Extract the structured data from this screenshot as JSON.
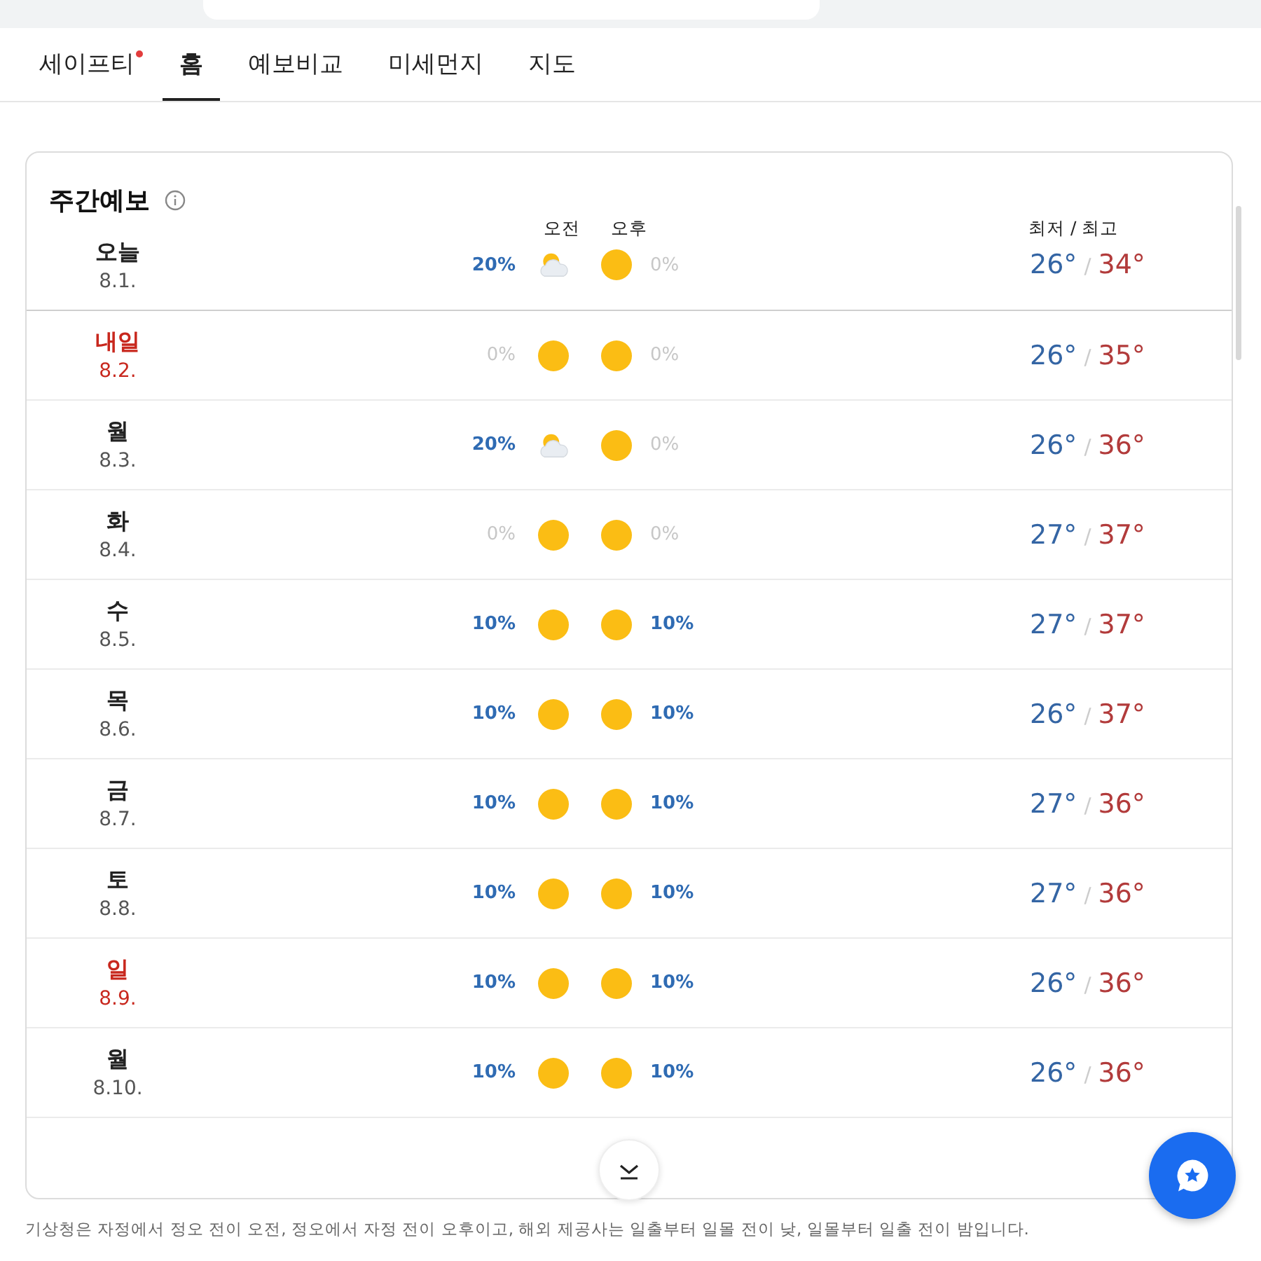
{
  "tabs": [
    {
      "label": "세이프티",
      "selected": false,
      "new_dot": true
    },
    {
      "label": "홈",
      "selected": true,
      "new_dot": false
    },
    {
      "label": "예보비교",
      "selected": false,
      "new_dot": false
    },
    {
      "label": "미세먼지",
      "selected": false,
      "new_dot": false
    },
    {
      "label": "지도",
      "selected": false,
      "new_dot": false
    }
  ],
  "card": {
    "title": "주간예보",
    "am_label": "오전",
    "pm_label": "오후",
    "temp_label": "최저 / 최고",
    "days": [
      {
        "day": "오늘",
        "date": "8.1.",
        "holiday": false,
        "am": {
          "rain": "20%",
          "rain_likely": true,
          "kind": "partly-cloudy"
        },
        "pm": {
          "kind": "sun",
          "rain": "0%",
          "rain_likely": false
        },
        "low": "26°",
        "sep": "/",
        "high": "34°"
      },
      {
        "day": "내일",
        "date": "8.2.",
        "holiday": true,
        "am": {
          "rain": "0%",
          "rain_likely": false,
          "kind": "sun"
        },
        "pm": {
          "kind": "sun",
          "rain": "0%",
          "rain_likely": false
        },
        "low": "26°",
        "sep": "/",
        "high": "35°"
      },
      {
        "day": "월",
        "date": "8.3.",
        "holiday": false,
        "am": {
          "rain": "20%",
          "rain_likely": true,
          "kind": "partly-cloudy"
        },
        "pm": {
          "kind": "sun",
          "rain": "0%",
          "rain_likely": false
        },
        "low": "26°",
        "sep": "/",
        "high": "36°"
      },
      {
        "day": "화",
        "date": "8.4.",
        "holiday": false,
        "am": {
          "rain": "0%",
          "rain_likely": false,
          "kind": "sun"
        },
        "pm": {
          "kind": "sun",
          "rain": "0%",
          "rain_likely": false
        },
        "low": "27°",
        "sep": "/",
        "high": "37°"
      },
      {
        "day": "수",
        "date": "8.5.",
        "holiday": false,
        "am": {
          "rain": "10%",
          "rain_likely": true,
          "kind": "sun"
        },
        "pm": {
          "kind": "sun",
          "rain": "10%",
          "rain_likely": true
        },
        "low": "27°",
        "sep": "/",
        "high": "37°"
      },
      {
        "day": "목",
        "date": "8.6.",
        "holiday": false,
        "am": {
          "rain": "10%",
          "rain_likely": true,
          "kind": "sun"
        },
        "pm": {
          "kind": "sun",
          "rain": "10%",
          "rain_likely": true
        },
        "low": "26°",
        "sep": "/",
        "high": "37°"
      },
      {
        "day": "금",
        "date": "8.7.",
        "holiday": false,
        "am": {
          "rain": "10%",
          "rain_likely": true,
          "kind": "sun"
        },
        "pm": {
          "kind": "sun",
          "rain": "10%",
          "rain_likely": true
        },
        "low": "27°",
        "sep": "/",
        "high": "36°"
      },
      {
        "day": "토",
        "date": "8.8.",
        "holiday": false,
        "am": {
          "rain": "10%",
          "rain_likely": true,
          "kind": "sun"
        },
        "pm": {
          "kind": "sun",
          "rain": "10%",
          "rain_likely": true
        },
        "low": "27°",
        "sep": "/",
        "high": "36°"
      },
      {
        "day": "일",
        "date": "8.9.",
        "holiday": true,
        "am": {
          "rain": "10%",
          "rain_likely": true,
          "kind": "sun"
        },
        "pm": {
          "kind": "sun",
          "rain": "10%",
          "rain_likely": true
        },
        "low": "26°",
        "sep": "/",
        "high": "36°"
      },
      {
        "day": "월",
        "date": "8.10.",
        "holiday": false,
        "am": {
          "rain": "10%",
          "rain_likely": true,
          "kind": "sun"
        },
        "pm": {
          "kind": "sun",
          "rain": "10%",
          "rain_likely": true
        },
        "low": "26°",
        "sep": "/",
        "high": "36°"
      }
    ]
  },
  "footnote": "기상청은 자정에서 정오 전이 오전, 정오에서 자정 전이 오후이고, 해외 제공사는 일출부터 일몰 전이 낮, 일몰부터 일출 전이 밤입니다."
}
